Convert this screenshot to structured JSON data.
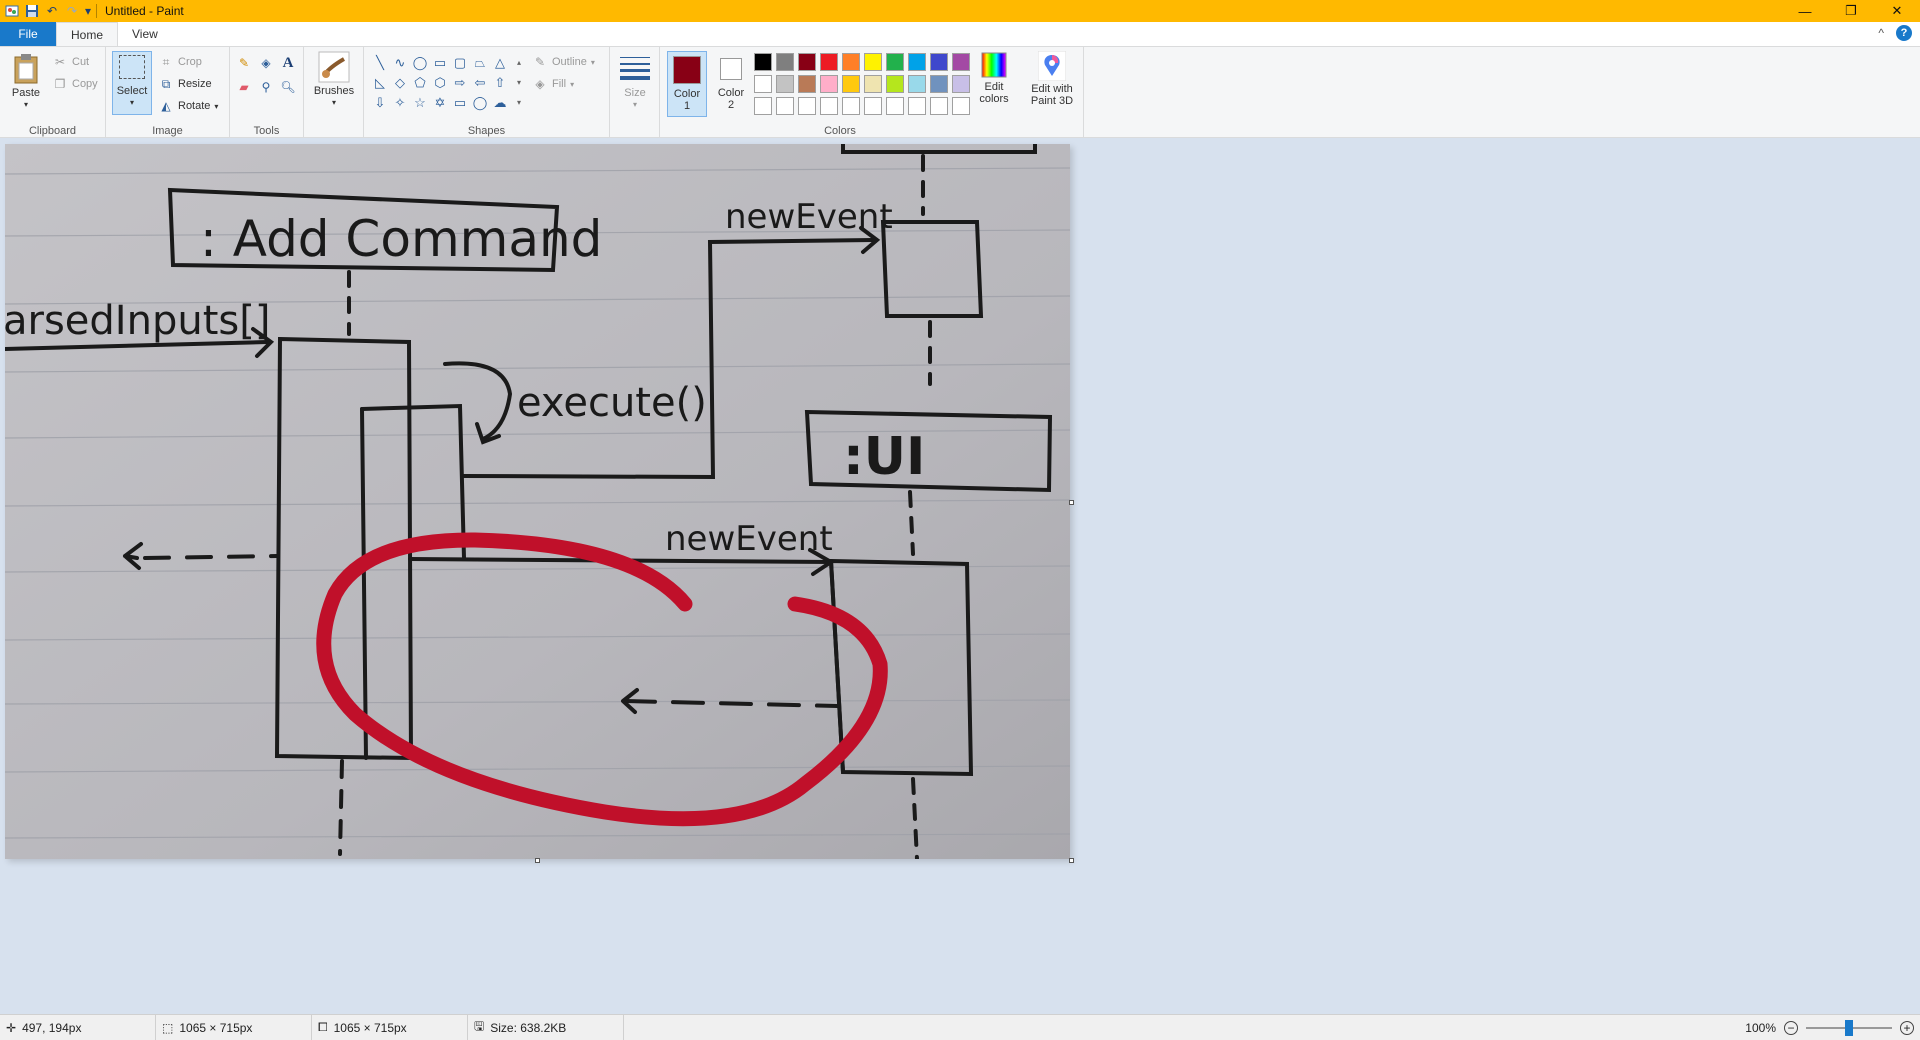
{
  "window": {
    "title": "Untitled - Paint",
    "minimize": "—",
    "maximize": "❐",
    "close": "✕"
  },
  "quick_access": {
    "save": "💾",
    "undo": "↶",
    "redo": "↷",
    "more": "▾"
  },
  "tabs": [
    {
      "label": "File"
    },
    {
      "label": "Home"
    },
    {
      "label": "View"
    }
  ],
  "ribbon_ctl": {
    "collapse": "^",
    "help": "?"
  },
  "clipboard": {
    "group": "Clipboard",
    "paste": "Paste",
    "cut": "Cut",
    "copy": "Copy"
  },
  "image": {
    "group": "Image",
    "select": "Select",
    "crop": "Crop",
    "resize": "Resize",
    "rotate": "Rotate"
  },
  "tools": {
    "group": "Tools"
  },
  "brushes": {
    "label": "Brushes"
  },
  "shapes": {
    "group": "Shapes",
    "outline": "Outline",
    "fill": "Fill"
  },
  "size": {
    "label": "Size"
  },
  "colors": {
    "group": "Colors",
    "color1": {
      "label": "Color",
      "sub": "1",
      "value": "#880015"
    },
    "color2": {
      "label": "Color",
      "sub": "2",
      "value": "#ffffff"
    },
    "edit": "Edit colors",
    "edit_lines": [
      "Edit",
      "colors"
    ],
    "paint3d_lines": [
      "Edit with",
      "Paint 3D"
    ],
    "palette_row1": [
      "#000000",
      "#7f7f7f",
      "#880015",
      "#ed1c24",
      "#ff7f27",
      "#fff200",
      "#22b14c",
      "#00a2e8",
      "#3f48cc",
      "#a349a4"
    ],
    "palette_row2": [
      "#ffffff",
      "#c3c3c3",
      "#b97a57",
      "#ffaec9",
      "#ffc90e",
      "#efe4b0",
      "#b5e61d",
      "#99d9ea",
      "#7092be",
      "#c8bfe7"
    ],
    "palette_row3": [
      "#ffffff",
      "#ffffff",
      "#ffffff",
      "#ffffff",
      "#ffffff",
      "#ffffff",
      "#ffffff",
      "#ffffff",
      "#ffffff",
      "#ffffff"
    ]
  },
  "canvas_image": {
    "texts": {
      "add_command": ": Add Command",
      "parsed_inputs": "arsedInputs[]",
      "new_event_top": "newEvent",
      "execute": "execute()",
      "ui": ":UI",
      "new_event_bottom": "newEvent"
    },
    "ink_color": "#1a1a1a",
    "red_mark_color": "#c0102a"
  },
  "status": {
    "cursor": "497, 194px",
    "selection": "1065 × 715px",
    "canvas_size": "1065 × 715px",
    "file_size": "Size: 638.2KB",
    "zoom": "100%",
    "zoom_level": 0.5
  }
}
